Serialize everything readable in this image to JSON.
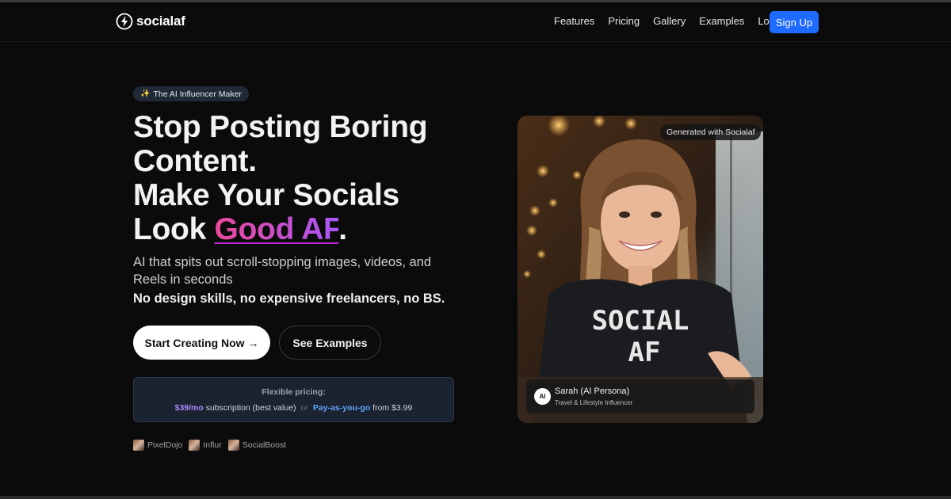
{
  "nav": {
    "brand": "socialaf",
    "links": [
      "Features",
      "Pricing",
      "Gallery",
      "Examples",
      "Login"
    ],
    "signup": "Sign Up"
  },
  "hero": {
    "badge_icon": "sparkles-icon",
    "badge": "The AI Influencer Maker",
    "headline_line1": "Stop Posting Boring",
    "headline_line2": "Content.",
    "headline_line3": "Make Your Socials",
    "headline_line4_pre": "Look ",
    "headline_accent": "Good AF",
    "headline_line4_post": ".",
    "subtitle": "AI that spits out scroll-stopping images, videos, and Reels in seconds",
    "subtitle_bold": "No design skills, no expensive freelancers, no BS.",
    "cta_primary": "Start Creating Now →",
    "cta_secondary": "See Examples"
  },
  "pricing": {
    "title": "Flexible pricing:",
    "subscription_price": "$39/mo",
    "subscription_text": " subscription (best value)",
    "or": "or",
    "payg_label": "Pay-as-you-go",
    "payg_text": " from $3.99"
  },
  "partners": [
    "PixelDojo",
    "Influr",
    "SocialBoost"
  ],
  "preview": {
    "badge": "Generated with Socialaf",
    "shirt_line1": "SOCIAL",
    "shirt_line2": "AF",
    "avatar_text": "AI",
    "persona_name": "Sarah (AI Persona)",
    "persona_role": "Travel & Lifestyle Influencer"
  },
  "colors": {
    "background": "#0b0b0b",
    "signup": "#1f6bff",
    "accent_pink": "#ec4899",
    "accent_purple": "#a855f7",
    "price_purple": "#a78bfa",
    "price_blue": "#60a5fa"
  }
}
